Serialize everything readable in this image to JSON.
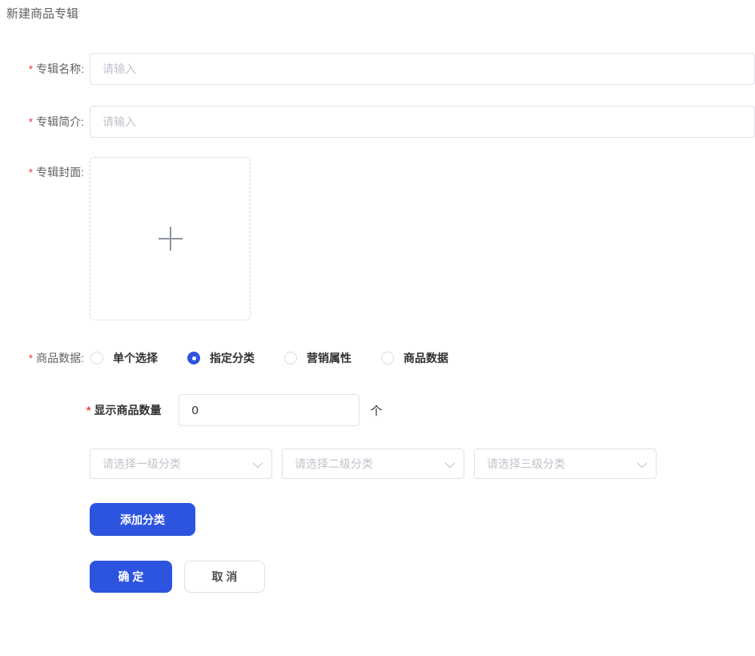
{
  "page": {
    "title": "新建商品专辑",
    "accent_color": "#2d54de",
    "required_mark": "*",
    "required_color": "#f03e3e"
  },
  "fields": {
    "album_name": {
      "label": "专辑名称:",
      "placeholder": "请输入",
      "value": "",
      "required": true
    },
    "album_intro": {
      "label": "专辑简介:",
      "placeholder": "请输入",
      "value": "",
      "required": true
    },
    "album_cover": {
      "label": "专辑封面:",
      "required": true,
      "upload_icon": "plus-icon"
    },
    "product_data": {
      "label": "商品数据:",
      "required": true,
      "options": [
        {
          "label": "单个选择",
          "selected": false
        },
        {
          "label": "指定分类",
          "selected": true
        },
        {
          "label": "营销属性",
          "selected": false
        },
        {
          "label": "商品数据",
          "selected": false
        }
      ]
    },
    "display_count": {
      "label": "显示商品数量",
      "value": "0",
      "unit": "个",
      "required": true
    },
    "category_selects": [
      {
        "placeholder": "请选择一级分类",
        "icon": "chevron-down-icon"
      },
      {
        "placeholder": "请选择二级分类",
        "icon": "chevron-down-icon"
      },
      {
        "placeholder": "请选择三级分类",
        "icon": "chevron-down-icon"
      }
    ]
  },
  "buttons": {
    "add_category": "添加分类",
    "confirm": "确 定",
    "cancel": "取 消"
  }
}
